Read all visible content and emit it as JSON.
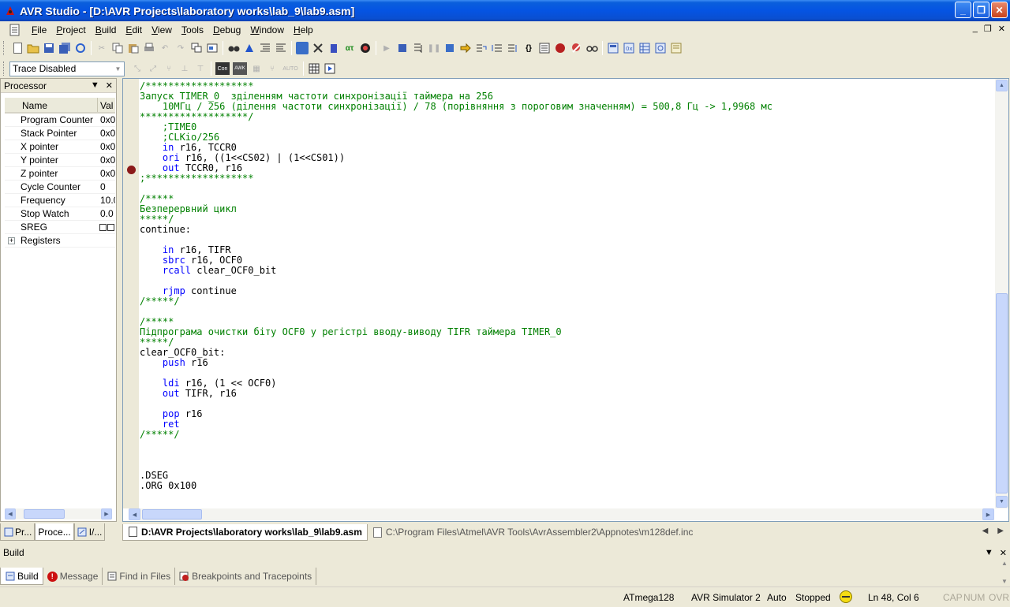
{
  "window": {
    "title": "AVR Studio - [D:\\AVR Projects\\laboratory works\\lab_9\\lab9.asm]",
    "minimize_glyph": "_",
    "maximize_glyph": "❐",
    "close_glyph": "✕"
  },
  "menu": {
    "items": [
      {
        "label": "File",
        "accel": "F",
        "rest": "ile"
      },
      {
        "label": "Project",
        "accel": "P",
        "rest": "roject"
      },
      {
        "label": "Build",
        "accel": "B",
        "rest": "uild"
      },
      {
        "label": "Edit",
        "accel": "E",
        "rest": "dit"
      },
      {
        "label": "View",
        "accel": "V",
        "rest": "iew"
      },
      {
        "label": "Tools",
        "accel": "T",
        "rest": "ools"
      },
      {
        "label": "Debug",
        "accel": "D",
        "rest": "ebug"
      },
      {
        "label": "Window",
        "accel": "W",
        "rest": "indow"
      },
      {
        "label": "Help",
        "accel": "H",
        "rest": "elp"
      }
    ],
    "mdi_minimize": "_",
    "mdi_restore": "❐",
    "mdi_close": "✕"
  },
  "toolbar2": {
    "trace_select_value": "Trace Disabled",
    "con_label": "Con",
    "awk_label": "AWK",
    "auto_label": "AUTO"
  },
  "processor_panel": {
    "title": "Processor",
    "col_name": "Name",
    "col_value": "Val",
    "rows": [
      {
        "name": "Program Counter",
        "value": "0x0"
      },
      {
        "name": "Stack Pointer",
        "value": "0x0"
      },
      {
        "name": "X pointer",
        "value": "0x0"
      },
      {
        "name": "Y pointer",
        "value": "0x0"
      },
      {
        "name": "Z pointer",
        "value": "0x0"
      },
      {
        "name": "Cycle Counter",
        "value": "0"
      },
      {
        "name": "Frequency",
        "value": "10.0"
      },
      {
        "name": "Stop Watch",
        "value": "0.0"
      },
      {
        "name": "SREG",
        "value": ""
      },
      {
        "name": "Registers",
        "value": "",
        "expander": "+"
      }
    ]
  },
  "left_tabs": [
    {
      "label": "Pr..."
    },
    {
      "label": "Proce..."
    },
    {
      "label": "I/..."
    }
  ],
  "editor": {
    "breakpoint_line": 8
  },
  "doc_tabs": {
    "active": "D:\\AVR Projects\\laboratory works\\lab_9\\lab9.asm",
    "inactive": "C:\\Program Files\\Atmel\\AVR Tools\\AvrAssembler2\\Appnotes\\m128def.inc"
  },
  "build_panel": {
    "title": "Build",
    "tabs": [
      {
        "label": "Build"
      },
      {
        "label": "Message"
      },
      {
        "label": "Find in Files"
      },
      {
        "label": "Breakpoints and Tracepoints"
      }
    ]
  },
  "status": {
    "device": "ATmega128",
    "simulator": "AVR Simulator 2",
    "mode": "Auto",
    "state": "Stopped",
    "position": "Ln 48, Col 6",
    "cap": "CAP",
    "num": "NUM",
    "ovr": "OVR"
  },
  "colors": {
    "comment": "#008000",
    "keyword": "#0000ff",
    "breakpoint": "#8b1a1a",
    "titlebar": "#0554e3"
  }
}
